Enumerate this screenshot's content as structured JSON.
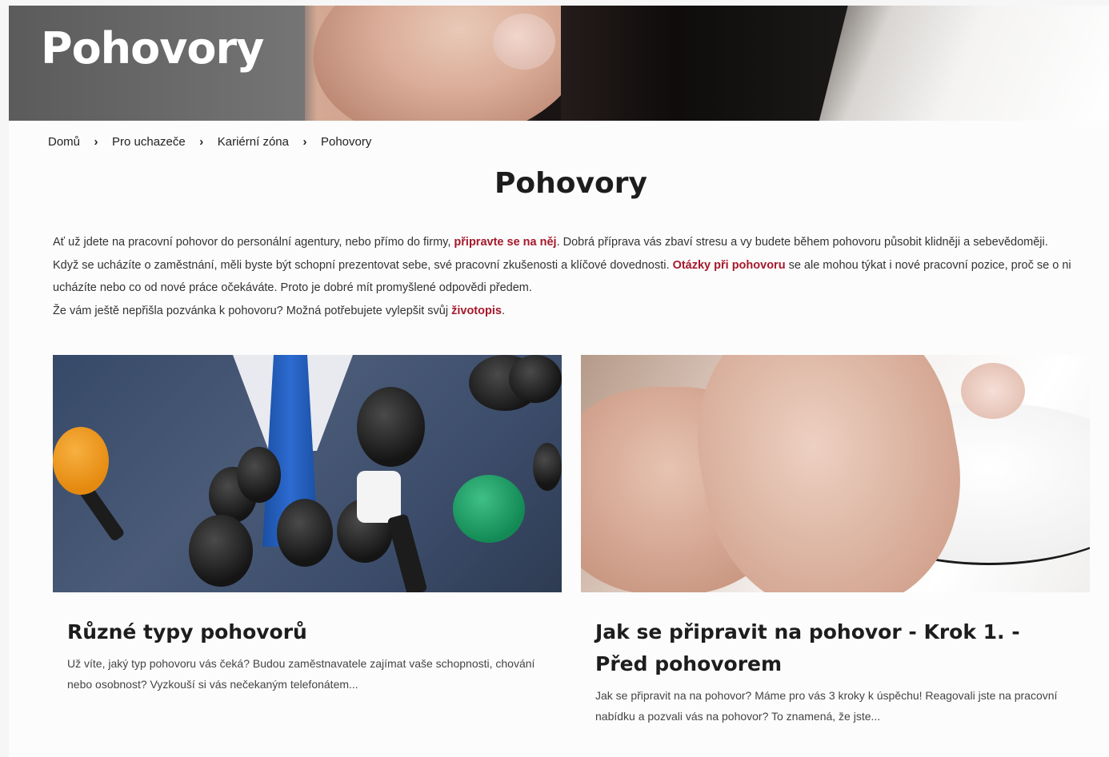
{
  "hero": {
    "title": "Pohovory"
  },
  "breadcrumb": {
    "items": [
      "Domů",
      "Pro uchazeče",
      "Kariérní zóna",
      "Pohovory"
    ],
    "separator": "›"
  },
  "main": {
    "title": "Pohovory",
    "intro": [
      {
        "before": "Ať už jdete na pracovní pohovor do personální agentury, nebo přímo do firmy, ",
        "link": "připravte se na něj",
        "after": ". Dobrá příprava vás zbaví stresu a vy budete během pohovoru působit klidněji a sebevědoměji."
      },
      {
        "before": "Když se ucházíte o zaměstnání, měli byste být schopní prezentovat sebe, své pracovní zkušenosti a klíčové dovednosti. ",
        "link": "Otázky při pohovoru",
        "after": " se ale mohou týkat i nové pracovní pozice, proč se o ni ucházíte nebo co od nové práce očekáváte. Proto je dobré mít promyšlené odpovědi předem."
      },
      {
        "before": "Že vám ještě nepřišla pozvánka k pohovoru? Možná potřebujete vylepšit svůj ",
        "link": "životopis",
        "after": "."
      }
    ]
  },
  "cards": [
    {
      "title": "Různé typy pohovorů",
      "text": "Už víte, jaký typ pohovoru vás čeká? Budou zaměstnavatele zajímat vaše schopnosti, chování nebo osobnost? Vyzkouší si vás nečekaným telefonátem..."
    },
    {
      "title": "Jak se připravit na pohovor - Krok 1. - Před pohovorem",
      "text": "Jak se připravit na na pohovor? Máme pro vás 3 kroky k úspěchu! Reagovali jste na pracovní nabídku a pozvali vás na pohovor? To znamená, že jste..."
    }
  ],
  "colors": {
    "accent": "#a5192b",
    "text": "#333333",
    "heading": "#1d1d1d"
  }
}
